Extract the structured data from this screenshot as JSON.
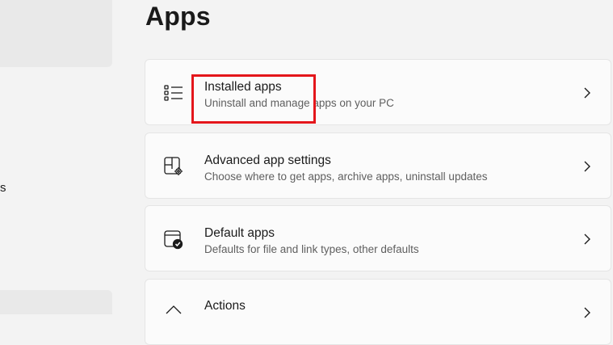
{
  "sidebar": {
    "fragment_text": "s"
  },
  "page": {
    "title": "Apps"
  },
  "cards": [
    {
      "title": "Installed apps",
      "description": "Uninstall and manage apps on your PC",
      "icon": "list-icon"
    },
    {
      "title": "Advanced app settings",
      "description": "Choose where to get apps, archive apps, uninstall updates",
      "icon": "app-settings-icon"
    },
    {
      "title": "Default apps",
      "description": "Defaults for file and link types, other defaults",
      "icon": "default-apps-icon"
    },
    {
      "title": "Actions",
      "description": "",
      "icon": "actions-icon"
    }
  ],
  "colors": {
    "highlight": "#e4161b",
    "background": "#f3f3f3",
    "card": "#fbfbfb"
  }
}
